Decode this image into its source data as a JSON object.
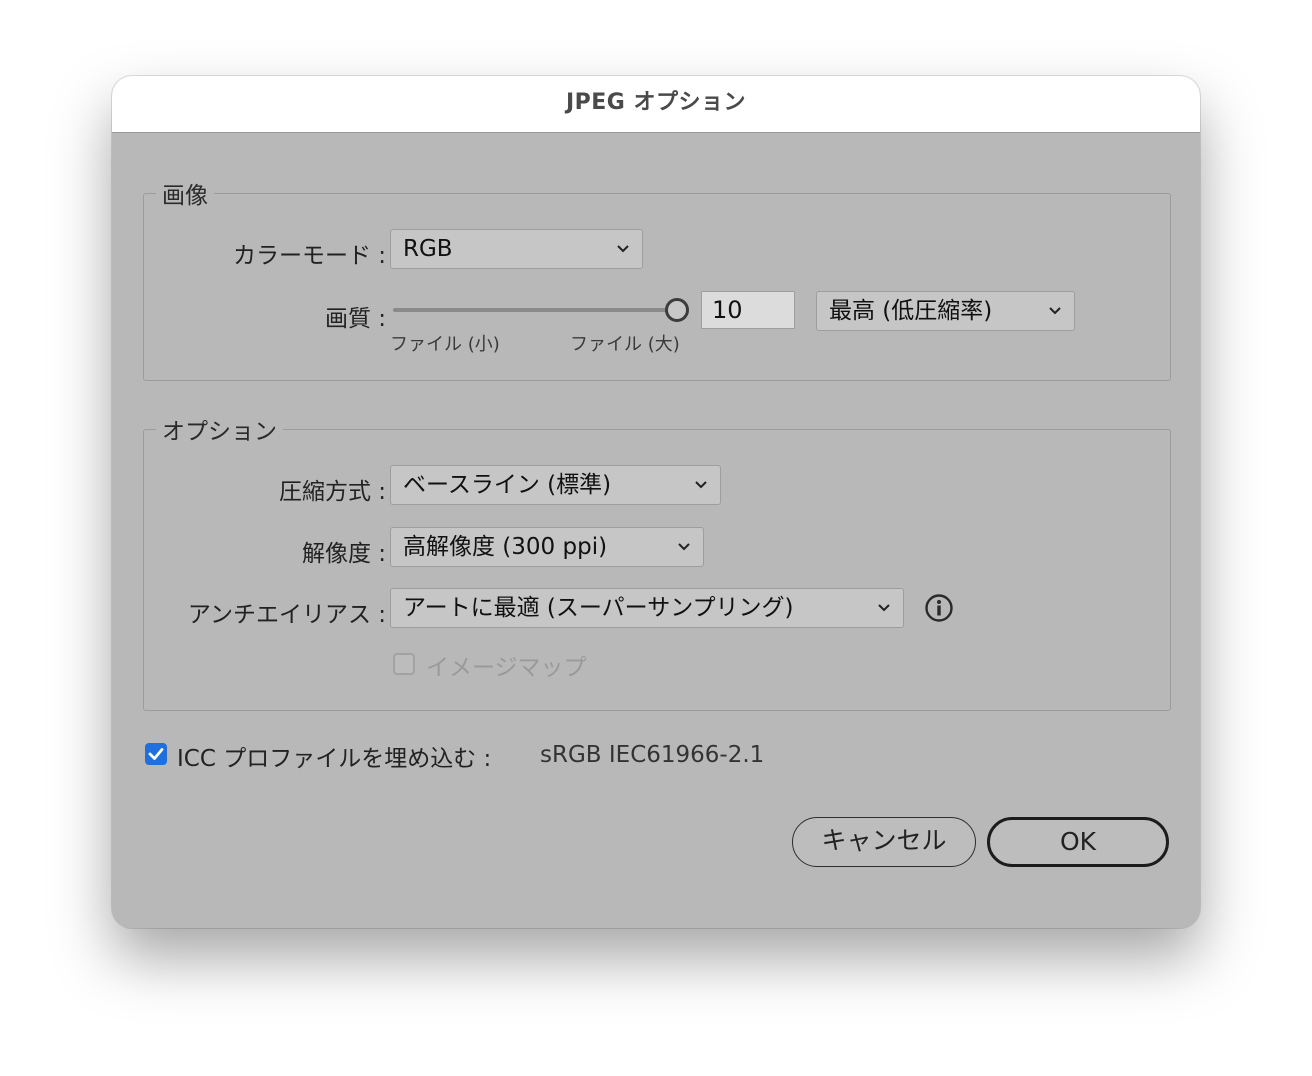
{
  "dialog": {
    "title": "JPEG オプション"
  },
  "image_group": {
    "label": "画像",
    "color_mode": {
      "label": "カラーモード :",
      "value": "RGB"
    },
    "quality": {
      "label": "画質 :",
      "slider_min_label": "ファイル (小)",
      "slider_max_label": "ファイル (大)",
      "slider_fraction": 1.0,
      "value": "10",
      "preset": "最高 (低圧縮率)"
    }
  },
  "options_group": {
    "label": "オプション",
    "compression": {
      "label": "圧縮方式 :",
      "value": "ベースライン (標準)"
    },
    "resolution": {
      "label": "解像度 :",
      "value": "高解像度 (300 ppi)"
    },
    "antialias": {
      "label": "アンチエイリアス :",
      "value": "アートに最適 (スーパーサンプリング)",
      "info_icon": "info-icon"
    },
    "imagemap": {
      "label": "イメージマップ",
      "checked": false,
      "enabled": false
    }
  },
  "icc_profile": {
    "label": "ICC プロファイルを埋め込む :",
    "value": "sRGB IEC61966-2.1",
    "checked": true
  },
  "buttons": {
    "cancel": "キャンセル",
    "ok": "OK"
  },
  "colors": {
    "dialog_bg": "#b8b8b8",
    "titlebar_bg": "#ffffff",
    "checkbox_accent": "#1f6fde"
  }
}
